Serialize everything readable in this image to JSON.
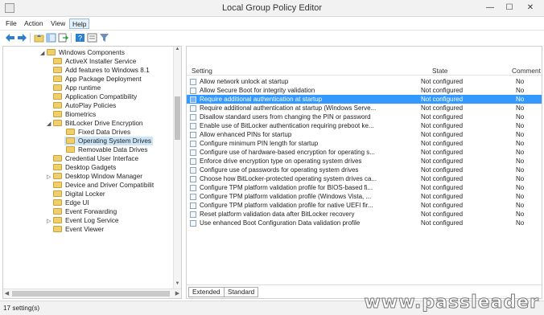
{
  "window": {
    "title": "Local Group Policy Editor",
    "controls": {
      "minimize": "—",
      "maximize": "☐",
      "close": "✕"
    }
  },
  "menu": [
    "File",
    "Action",
    "View",
    "Help"
  ],
  "toolbar_icons": [
    "back-arrow-icon",
    "forward-arrow-icon",
    "up-folder-icon",
    "show-hide-tree-icon",
    "export-list-icon",
    "help-icon",
    "properties-icon",
    "filter-icon"
  ],
  "tree": [
    {
      "label": "Windows Components",
      "expanded": true
    },
    {
      "label": "ActiveX Installer Service"
    },
    {
      "label": "Add features to Windows 8.1"
    },
    {
      "label": "App Package Deployment"
    },
    {
      "label": "App runtime"
    },
    {
      "label": "Application Compatibility"
    },
    {
      "label": "AutoPlay Policies"
    },
    {
      "label": "Biometrics"
    },
    {
      "label": "BitLocker Drive Encryption",
      "expanded": true
    },
    {
      "label": "Fixed Data Drives"
    },
    {
      "label": "Operating System Drives",
      "selected": true
    },
    {
      "label": "Removable Data Drives"
    },
    {
      "label": "Credential User Interface"
    },
    {
      "label": "Desktop Gadgets"
    },
    {
      "label": "Desktop Window Manager",
      "collapsed": true
    },
    {
      "label": "Device and Driver Compatibilit"
    },
    {
      "label": "Digital Locker"
    },
    {
      "label": "Edge UI"
    },
    {
      "label": "Event Forwarding"
    },
    {
      "label": "Event Log Service",
      "collapsed": true
    },
    {
      "label": "Event Viewer"
    }
  ],
  "grid": {
    "headers": {
      "setting": "Setting",
      "state": "State",
      "comment": "Comment"
    },
    "rows": [
      {
        "name": "Allow network unlock at startup",
        "state": "Not configured",
        "comment": "No"
      },
      {
        "name": "Allow Secure Boot for integrity validation",
        "state": "Not configured",
        "comment": "No"
      },
      {
        "name": "Require additional authentication at startup",
        "state": "Not configured",
        "comment": "No",
        "selected": true
      },
      {
        "name": "Require additional authentication at startup (Windows Serve...",
        "state": "Not configured",
        "comment": "No"
      },
      {
        "name": "Disallow standard users from changing the PIN or password",
        "state": "Not configured",
        "comment": "No"
      },
      {
        "name": "Enable use of BitLocker authentication requiring preboot ke...",
        "state": "Not configured",
        "comment": "No"
      },
      {
        "name": "Allow enhanced PINs for startup",
        "state": "Not configured",
        "comment": "No"
      },
      {
        "name": "Configure minimum PIN length for startup",
        "state": "Not configured",
        "comment": "No"
      },
      {
        "name": "Configure use of hardware-based encryption for operating s...",
        "state": "Not configured",
        "comment": "No"
      },
      {
        "name": "Enforce drive encryption type on operating system drives",
        "state": "Not configured",
        "comment": "No"
      },
      {
        "name": "Configure use of passwords for operating system drives",
        "state": "Not configured",
        "comment": "No"
      },
      {
        "name": "Choose how BitLocker-protected operating system drives ca...",
        "state": "Not configured",
        "comment": "No"
      },
      {
        "name": "Configure TPM platform validation profile for BIOS-based fi...",
        "state": "Not configured",
        "comment": "No"
      },
      {
        "name": "Configure TPM platform validation profile (Windows Vista, ...",
        "state": "Not configured",
        "comment": "No"
      },
      {
        "name": "Configure TPM platform validation profile for native UEFI fir...",
        "state": "Not configured",
        "comment": "No"
      },
      {
        "name": "Reset platform validation data after BitLocker recovery",
        "state": "Not configured",
        "comment": "No"
      },
      {
        "name": "Use enhanced Boot Configuration Data validation profile",
        "state": "Not configured",
        "comment": "No"
      }
    ]
  },
  "tabs": [
    "Extended",
    "Standard"
  ],
  "status": "17 setting(s)",
  "watermark": "www.passleader",
  "colors": {
    "selection": "#3399ff",
    "tree_selection": "#cde6f7",
    "folder": "#f0cf6a"
  }
}
